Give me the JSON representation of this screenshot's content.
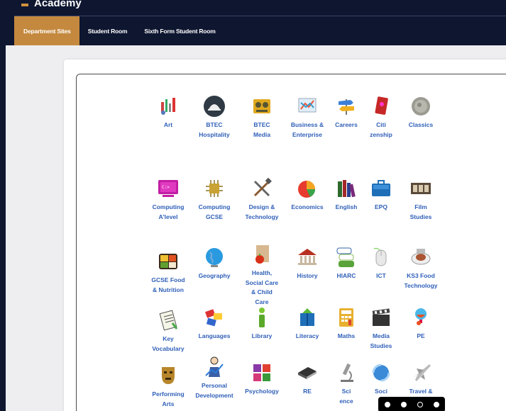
{
  "header": {
    "brand": "Academy",
    "accent_color": "#c4893e"
  },
  "nav": [
    {
      "label": "Department Sites",
      "active": true
    },
    {
      "label": "Student Room",
      "active": false
    },
    {
      "label": "Sixth Form Student Room",
      "active": false
    }
  ],
  "departments": [
    {
      "label": "Art",
      "icon": "palette-icon"
    },
    {
      "label": "BTEC\nHospitality",
      "icon": "serving-cloche-icon"
    },
    {
      "label": "BTEC\nMedia",
      "icon": "film-reel-icon"
    },
    {
      "label": "Business &\nEnterprise",
      "icon": "chart-board-icon"
    },
    {
      "label": "Careers",
      "icon": "signpost-icon"
    },
    {
      "label": "Citi\nzenship",
      "icon": "passport-icon"
    },
    {
      "label": "Classics",
      "icon": "coin-icon"
    },
    {
      "label": "Computing\nA'level",
      "icon": "terminal-icon"
    },
    {
      "label": "Computing\nGCSE",
      "icon": "chip-icon"
    },
    {
      "label": "Design &\nTechnology",
      "icon": "tools-icon"
    },
    {
      "label": "Economics",
      "icon": "pie-chart-icon"
    },
    {
      "label": "English",
      "icon": "books-icon"
    },
    {
      "label": "EPQ",
      "icon": "briefcase-icon"
    },
    {
      "label": "Film\nStudies",
      "icon": "film-strip-icon"
    },
    {
      "label": "GCSE Food\n& Nutrition",
      "icon": "bento-box-icon"
    },
    {
      "label": "Geography",
      "icon": "globe-icon"
    },
    {
      "label": "Health,\nSocial Care\n& Child\nCare",
      "icon": "apple-bag-icon"
    },
    {
      "label": "History",
      "icon": "museum-icon"
    },
    {
      "label": "HIARC",
      "icon": "speech-bubbles-icon"
    },
    {
      "label": "ICT",
      "icon": "mouse-icon"
    },
    {
      "label": "KS3 Food\nTechnology",
      "icon": "dinner-plate-icon"
    },
    {
      "label": "Key\nVocabulary",
      "icon": "notepad-icon"
    },
    {
      "label": "Languages",
      "icon": "flags-icon"
    },
    {
      "label": "Library",
      "icon": "info-icon"
    },
    {
      "label": "Literacy",
      "icon": "library-books-icon"
    },
    {
      "label": "Maths",
      "icon": "calculator-icon"
    },
    {
      "label": "Media\nStudies",
      "icon": "clapperboard-icon"
    },
    {
      "label": "PE",
      "icon": "trophy-icon"
    },
    {
      "label": "Performing\nArts",
      "icon": "theatre-mask-icon"
    },
    {
      "label": "Personal\nDevelopment",
      "icon": "person-chart-icon"
    },
    {
      "label": "Psychology",
      "icon": "puzzle-blocks-icon"
    },
    {
      "label": "RE",
      "icon": "bible-icon"
    },
    {
      "label": "Sci\nence",
      "icon": "microscope-icon"
    },
    {
      "label": "Soci",
      "icon": "globe-arrows-icon"
    },
    {
      "label": "Travel &",
      "icon": "airplane-icon"
    }
  ],
  "carousel": {
    "slides": 4,
    "active_index": 2
  }
}
